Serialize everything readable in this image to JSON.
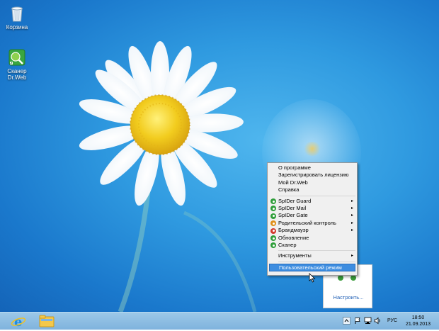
{
  "desktop": {
    "icons": [
      {
        "label": "Корзина",
        "icon": "recycle-bin-icon"
      },
      {
        "label": "Сканер Dr.Web",
        "icon": "drweb-scanner-icon"
      }
    ]
  },
  "context_menu": {
    "top_items": [
      {
        "label": "О программе"
      },
      {
        "label": "Зарегистрировать лицензию"
      },
      {
        "label": "Мой Dr.Web"
      },
      {
        "label": "Справка"
      }
    ],
    "component_items": [
      {
        "label": "SpIDer Guard",
        "submenu": true,
        "color": "#2e9e3a"
      },
      {
        "label": "SpIDer Mail",
        "submenu": true,
        "color": "#2e9e3a"
      },
      {
        "label": "SpIDer Gate",
        "submenu": true,
        "color": "#2e9e3a"
      },
      {
        "label": "Родительский контроль",
        "submenu": true,
        "color": "#e0901a"
      },
      {
        "label": "Брандмауэр",
        "submenu": true,
        "color": "#d23b2e"
      },
      {
        "label": "Обновление",
        "submenu": false,
        "color": "#2e9e3a"
      },
      {
        "label": "Сканер",
        "submenu": false,
        "color": "#2e9e3a"
      }
    ],
    "tools_item": {
      "label": "Инструменты",
      "submenu": true
    },
    "highlighted_item": {
      "label": "Пользовательский режим"
    },
    "submenu_arrow": "▸"
  },
  "tray_overflow": {
    "customize_link": "Настроить..."
  },
  "taskbar": {
    "language": "РУС",
    "time": "18:50",
    "date": "21.09.2013"
  }
}
